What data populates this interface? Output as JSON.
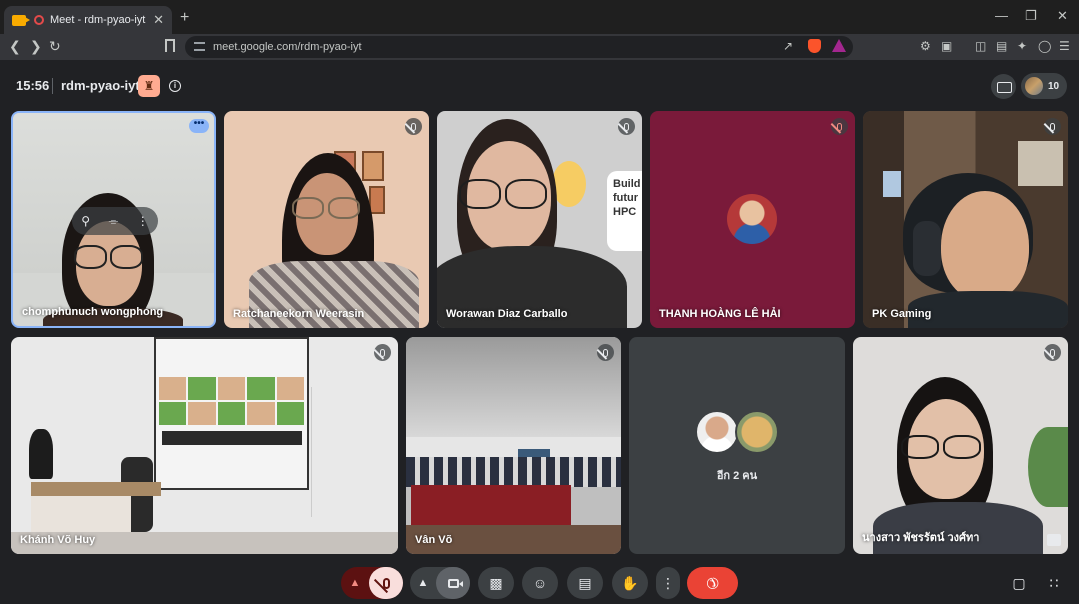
{
  "browser": {
    "tab_title": "Meet - rdm-pyao-iyt",
    "tab_close": "✕",
    "new_tab": "+",
    "url": "meet.google.com/rdm-pyao-iyt",
    "window_controls": [
      "—",
      "❐",
      "✕"
    ]
  },
  "meeting": {
    "time": "15:56",
    "code": "rdm-pyao-iyt",
    "participant_count": "10"
  },
  "participants": [
    {
      "name": "chomphunuch wongphong",
      "muted": false
    },
    {
      "name": "Ratchaneekorn Weerasin",
      "muted": true
    },
    {
      "name": "Worawan Diaz Carballo",
      "muted": true
    },
    {
      "name": "THANH HOÀNG LÊ HẢI",
      "muted": true
    },
    {
      "name": "PK Gaming",
      "muted": true
    },
    {
      "name": "Khánh Võ Huy",
      "muted": true
    },
    {
      "name": "Vân Võ",
      "muted": true
    },
    {
      "name": "อีก 2 คน",
      "muted": false
    },
    {
      "name": "นางสาว พัชรรัตน์ วงศ์ทา",
      "muted": true
    }
  ],
  "background_text": {
    "board_text": "Build futur HPC"
  },
  "controls": {
    "icons": [
      "chevron-up-icon",
      "mic-off-icon",
      "chevron-up-icon",
      "camera-icon",
      "present-icon",
      "emoji-icon",
      "captions-icon",
      "raise-hand-icon",
      "more-icon",
      "end-call-icon",
      "chat-icon",
      "activities-icon"
    ]
  },
  "colors": {
    "accent_blue": "#8ab4f8",
    "end_call_red": "#ea4335",
    "muted_mic_bg": "#f9dedc"
  }
}
